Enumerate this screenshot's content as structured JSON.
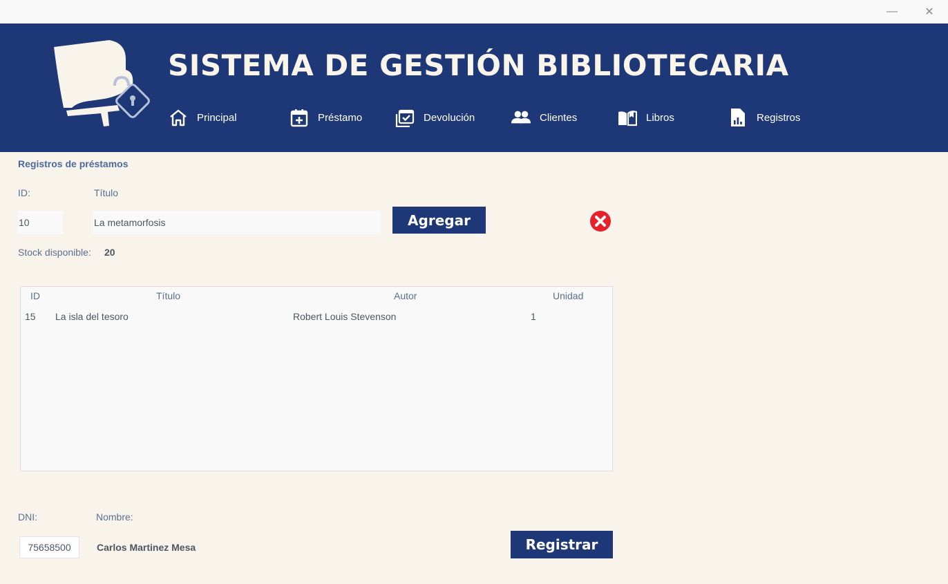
{
  "window": {
    "minimize_glyph": "—",
    "close_glyph": "✕"
  },
  "header": {
    "title": "SISTEMA DE GESTIÓN BIBLIOTECARIA",
    "logo_icon": "book-lock-logo",
    "background_color": "#1e3776"
  },
  "nav": {
    "items": [
      {
        "label": "Principal",
        "icon": "home-icon"
      },
      {
        "label": "Préstamo",
        "icon": "calendar-plus-icon"
      },
      {
        "label": "Devolución",
        "icon": "calendar-check-icon"
      },
      {
        "label": "Clientes",
        "icon": "users-icon"
      },
      {
        "label": "Libros",
        "icon": "open-book-icon"
      },
      {
        "label": "Registros",
        "icon": "report-icon"
      }
    ]
  },
  "form": {
    "section_title": "Registros de préstamos",
    "id_label": "ID:",
    "id_value": "10",
    "title_label": "Título",
    "title_value": "La metamorfosis",
    "add_button": "Agregar",
    "stock_label": "Stock disponible:",
    "stock_value": "20"
  },
  "table": {
    "columns": [
      "ID",
      "Título",
      "Autor",
      "Unidad"
    ],
    "rows": [
      {
        "id": "15",
        "titulo": "La isla del tesoro",
        "autor": "Robert Louis Stevenson",
        "unidad": "1"
      }
    ]
  },
  "client": {
    "dni_label": "DNI:",
    "dni_value": "75658500",
    "name_label": "Nombre:",
    "name_value": "Carlos Martinez Mesa",
    "register_button": "Registrar"
  },
  "colors": {
    "accent": "#1e3776",
    "background": "#f8f4eb",
    "danger": "#e8202a"
  }
}
